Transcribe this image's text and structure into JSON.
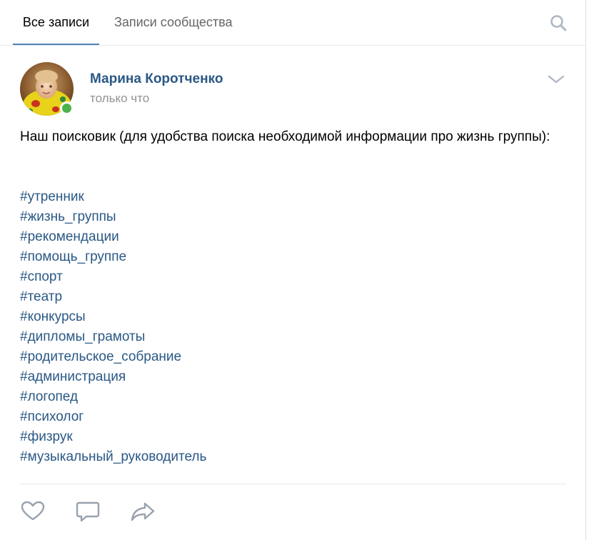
{
  "tabs": [
    {
      "label": "Все записи",
      "active": true
    },
    {
      "label": "Записи сообщества",
      "active": false
    }
  ],
  "icons": {
    "search": "search-icon",
    "expand": "chevron-down-icon",
    "like": "heart-icon",
    "comment": "comment-icon",
    "share": "share-arrow-icon"
  },
  "post": {
    "author": "Марина Коротченко",
    "time": "только что",
    "online": true,
    "text": "Наш поисковик (для удобства поиска необходимой информации про жизнь группы):",
    "hashtags": [
      "#утренник",
      "#жизнь_группы",
      "#рекомендации",
      "#помощь_группе",
      "#спорт",
      "#театр",
      "#конкурсы",
      "#дипломы_грамоты",
      "#родительское_собрание",
      "#администрация",
      "#логопед",
      "#психолог",
      "#физрук",
      "#музыкальный_руководитель"
    ]
  },
  "colors": {
    "link": "#2a5885",
    "accent": "#5181b8",
    "muted": "#939393",
    "icon": "#99a2ad",
    "online": "#4bb34b"
  }
}
